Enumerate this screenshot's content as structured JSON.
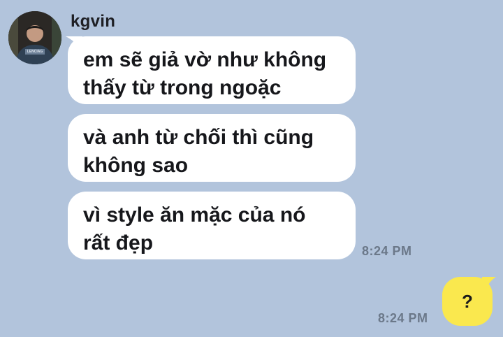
{
  "contact": {
    "name": "kgvin",
    "avatar_icon": "profile-photo",
    "avatar_print": "LENCIAG"
  },
  "messages_received": [
    {
      "line1": "em sẽ giả vờ như không",
      "line2": "thấy từ trong ngoặc"
    },
    {
      "line1": "và anh từ chối thì cũng",
      "line2": "không sao"
    },
    {
      "line1": "vì style ăn mặc của nó",
      "line2": "rất đẹp"
    }
  ],
  "received_time": "8:24 PM",
  "message_sent": {
    "text": "?",
    "time": "8:24 PM"
  },
  "colors": {
    "background": "#b2c4dc",
    "received_bubble": "#ffffff",
    "sent_bubble": "#fae84e",
    "timestamp": "#6b7889"
  }
}
